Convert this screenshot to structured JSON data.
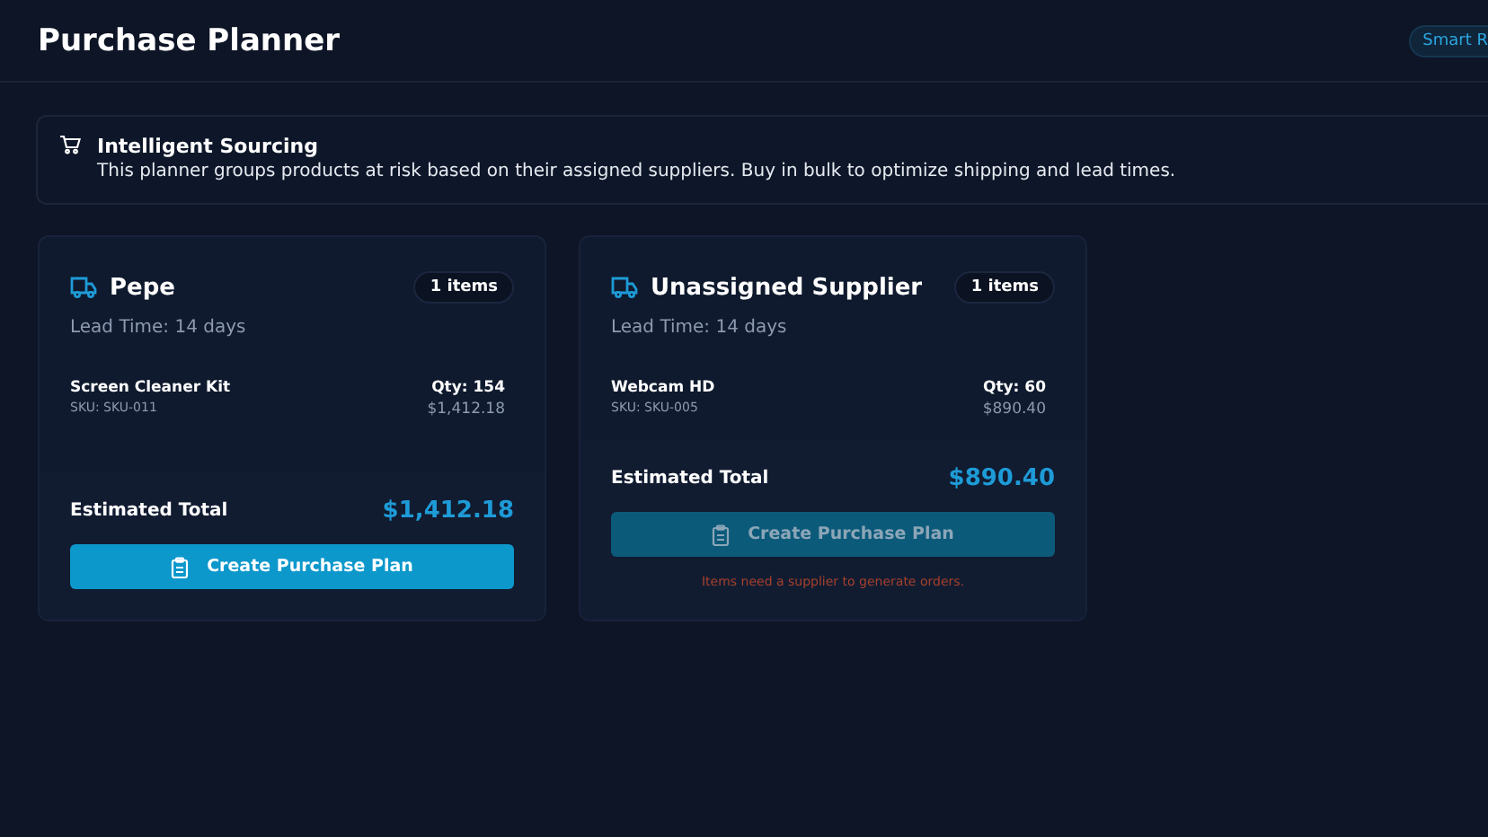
{
  "header": {
    "title": "Purchase Planner",
    "badge": "Smart R"
  },
  "info": {
    "title": "Intelligent Sourcing",
    "text": "This planner groups products at risk based on their assigned suppliers. Buy in bulk to optimize shipping and lead times."
  },
  "suppliers": [
    {
      "name": "Pepe",
      "count": "1 items",
      "lead_time": "Lead Time: 14 days",
      "items": [
        {
          "name": "Screen Cleaner Kit",
          "sku": "SKU: SKU-011",
          "qty": "Qty: 154",
          "cost": "$1,412.18"
        }
      ],
      "total_label": "Estimated Total",
      "total": "$1,412.18",
      "button": {
        "label": "Create Purchase Plan",
        "disabled": false
      }
    },
    {
      "name": "Unassigned Supplier",
      "count": "1 items",
      "lead_time": "Lead Time: 14 days",
      "items": [
        {
          "name": "Webcam HD",
          "sku": "SKU: SKU-005",
          "qty": "Qty: 60",
          "cost": "$890.40"
        }
      ],
      "total_label": "Estimated Total",
      "total": "$890.40",
      "button": {
        "label": "Create Purchase Plan",
        "disabled": true
      },
      "warning": "Items need a supplier to generate orders."
    }
  ]
}
